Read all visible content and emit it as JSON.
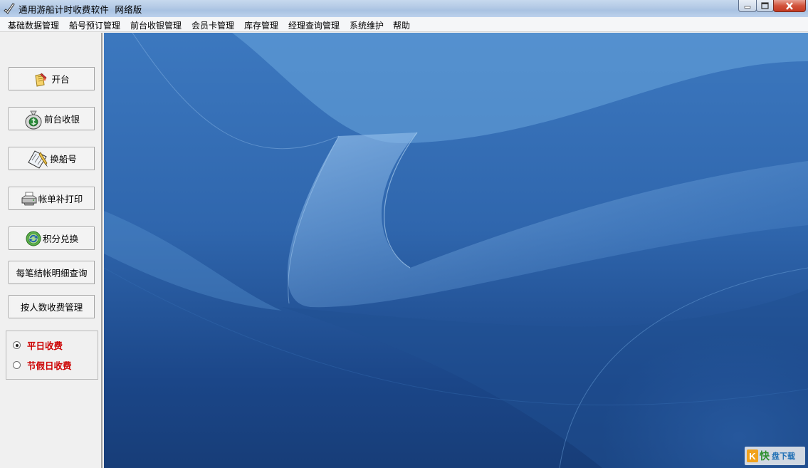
{
  "window": {
    "title": "通用游船计时收费软件",
    "edition": "网络版",
    "controls": {
      "minimize": "minimize-icon",
      "maximize": "maximize-icon",
      "close": "close-icon"
    }
  },
  "menu": [
    "基础数据管理",
    "船号预订管理",
    "前台收银管理",
    "会员卡管理",
    "库存管理",
    "经理查询管理",
    "系统维护",
    "帮助"
  ],
  "sidebar": {
    "buttons": [
      {
        "label": "开台",
        "icon": "open-table-icon"
      },
      {
        "label": "前台收银",
        "icon": "money-bag-icon"
      },
      {
        "label": "换船号",
        "icon": "swap-boat-icon"
      },
      {
        "label": "帐单补打印",
        "icon": "printer-icon"
      },
      {
        "label": "积分兑换",
        "icon": "exchange-points-icon"
      },
      {
        "label": "每笔结帐明细查询",
        "icon": ""
      },
      {
        "label": "按人数收费管理",
        "icon": ""
      }
    ],
    "charge_mode": {
      "options": [
        {
          "label": "平日收费",
          "selected": true
        },
        {
          "label": "节假日收费",
          "selected": false
        }
      ]
    }
  },
  "watermark": {
    "badge": "K",
    "brand_char": "快",
    "brand": "盘下载"
  },
  "colors": {
    "titlebar": "#b5cbe6",
    "desktop_blue": "#2a5a9a",
    "radio_label": "#cc0000"
  }
}
